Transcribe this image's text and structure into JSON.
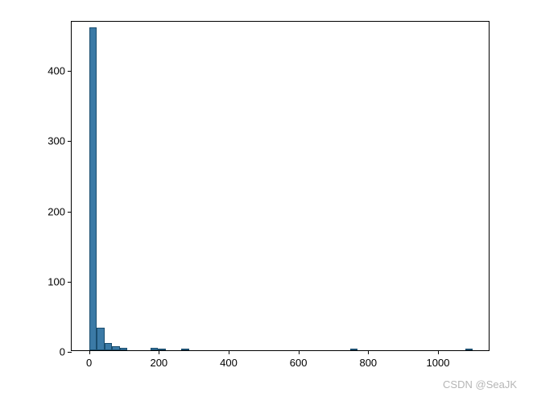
{
  "chart_data": {
    "type": "bar",
    "title": "",
    "xlabel": "",
    "ylabel": "",
    "xlim": [
      -50,
      1150
    ],
    "ylim": [
      0,
      470
    ],
    "x_ticks": [
      0,
      200,
      400,
      600,
      800,
      1000
    ],
    "y_ticks": [
      0,
      100,
      200,
      300,
      400
    ],
    "bins": [
      {
        "x_start": 0,
        "x_end": 22,
        "count": 460
      },
      {
        "x_start": 22,
        "x_end": 44,
        "count": 32
      },
      {
        "x_start": 44,
        "x_end": 66,
        "count": 10
      },
      {
        "x_start": 66,
        "x_end": 88,
        "count": 6
      },
      {
        "x_start": 88,
        "x_end": 110,
        "count": 4
      },
      {
        "x_start": 176,
        "x_end": 198,
        "count": 3
      },
      {
        "x_start": 198,
        "x_end": 220,
        "count": 2
      },
      {
        "x_start": 264,
        "x_end": 286,
        "count": 2
      },
      {
        "x_start": 748,
        "x_end": 770,
        "count": 2
      },
      {
        "x_start": 1078,
        "x_end": 1100,
        "count": 2
      }
    ]
  },
  "watermark": "CSDN @SeaJK"
}
